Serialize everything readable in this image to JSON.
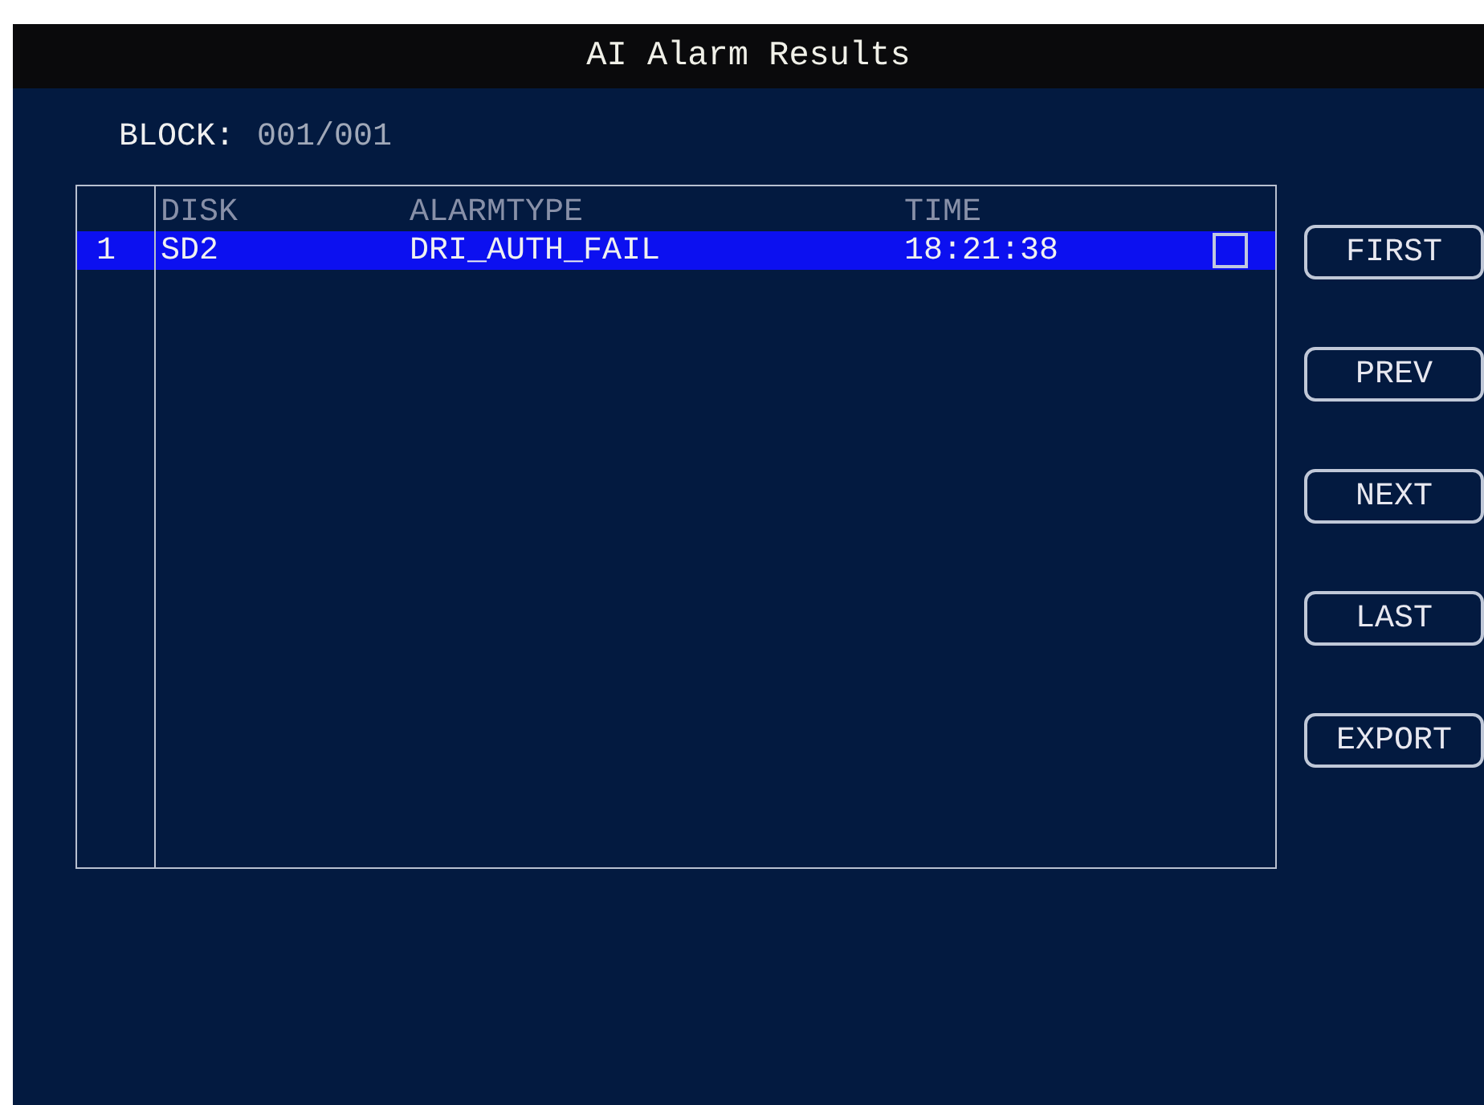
{
  "window": {
    "title": "AI Alarm Results"
  },
  "block": {
    "label": "BLOCK:",
    "value": "001/001"
  },
  "table": {
    "columns": [
      "DISK",
      "ALARMTYPE",
      "TIME"
    ],
    "rows": [
      {
        "index": "1",
        "disk": "SD2",
        "alarm_type": "DRI_AUTH_FAIL",
        "time": "18:21:38",
        "selected": true,
        "checked": false
      }
    ]
  },
  "buttons": [
    "FIRST",
    "PREV",
    "NEXT",
    "LAST",
    "EXPORT"
  ]
}
